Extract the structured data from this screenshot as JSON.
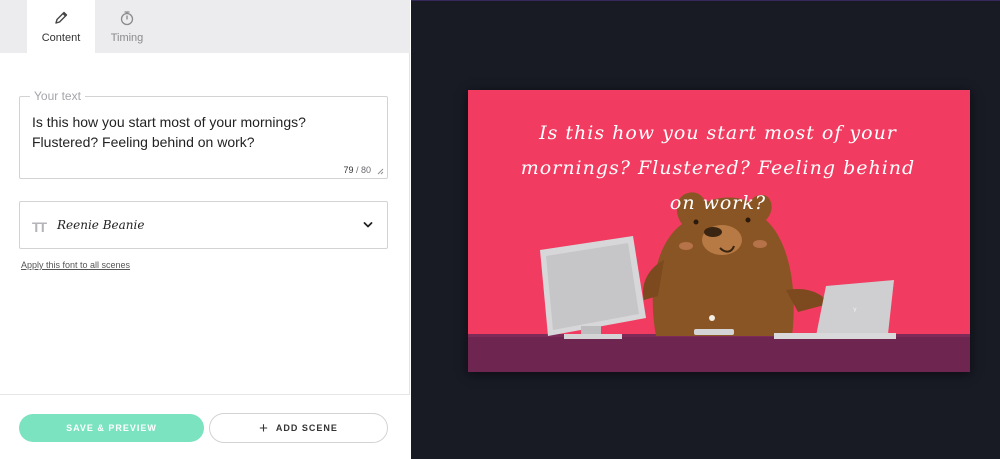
{
  "tabs": [
    {
      "label": "Content",
      "icon": "pencil-icon",
      "active": true
    },
    {
      "label": "Timing",
      "icon": "stopwatch-icon",
      "active": false
    }
  ],
  "text_field": {
    "legend": "Your text",
    "value": "Is this how you start most of your mornings?\nFlustered? Feeling behind on work?",
    "char_count": "79",
    "char_max": "/ 80"
  },
  "font_picker": {
    "icon_text": "TT",
    "selected_font": "Reenie Beanie"
  },
  "apply_font_link": "Apply this font to all scenes",
  "buttons": {
    "save_preview": "SAVE & PREVIEW",
    "add_scene": "ADD SCENE",
    "add_scene_icon": "+"
  },
  "preview": {
    "caption": "Is this how you start most of your mornings? Flustered? Feeling behind on work?",
    "colors": {
      "background": "#f23b60",
      "desk": "#6e2550",
      "bear": "#8a5524"
    }
  }
}
